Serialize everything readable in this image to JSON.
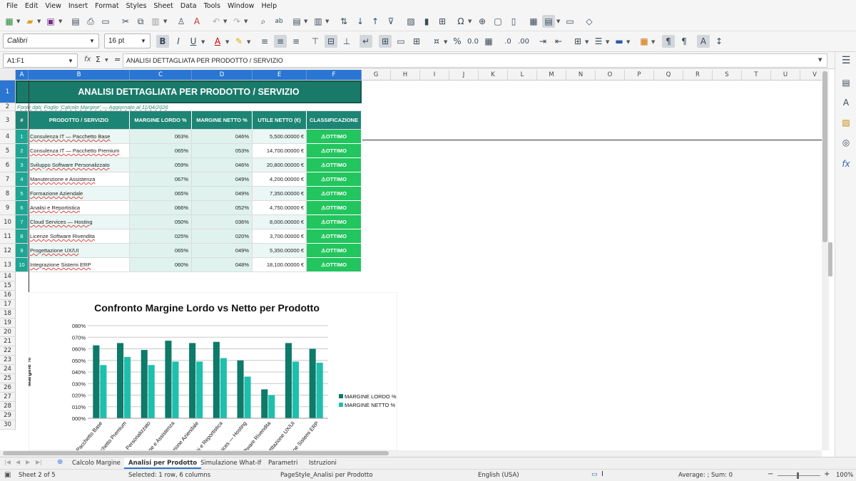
{
  "menu": [
    "File",
    "Edit",
    "View",
    "Insert",
    "Format",
    "Styles",
    "Sheet",
    "Data",
    "Tools",
    "Window",
    "Help"
  ],
  "font": {
    "name": "Calibri",
    "size": "16 pt"
  },
  "formula_bar": {
    "cell_ref": "A1:F1",
    "content": "ANALISI DETTAGLIATA PER PRODOTTO / SERVIZIO",
    "fx": "fx",
    "sigma": "Σ",
    "equals": "="
  },
  "columns": [
    "A",
    "B",
    "C",
    "D",
    "E",
    "F",
    "G",
    "H",
    "I",
    "J",
    "K",
    "L",
    "M",
    "N",
    "O",
    "P",
    "Q",
    "R",
    "S",
    "T",
    "U",
    "V"
  ],
  "rows": [
    "1",
    "2",
    "3",
    "4",
    "5",
    "6",
    "7",
    "8",
    "9",
    "10",
    "11",
    "12",
    "13",
    "14",
    "15",
    "16",
    "17",
    "18",
    "19",
    "20",
    "21",
    "22",
    "23",
    "24",
    "25",
    "26",
    "27",
    "28",
    "29",
    "30"
  ],
  "sheet": {
    "title": "ANALISI DETTAGLIATA PER PRODOTTO / SERVIZIO",
    "subtitle": "Fonte dati: Foglio 'Calcolo Margine' — Aggiornato al 11/04/2026",
    "headers": [
      "#",
      "PRODOTTO / SERVIZIO",
      "MARGINE LORDO %",
      "MARGINE NETTO %",
      "UTILE NETTO (€)",
      "CLASSIFICAZIONE"
    ],
    "table": [
      [
        "1",
        "Consulenza IT — Pacchetto Base",
        "063%",
        "046%",
        "5,500.00000 €",
        "⚠OTTIMO"
      ],
      [
        "2",
        "Consulenza IT — Pacchetto Premium",
        "065%",
        "053%",
        "14,700.00000 €",
        "⚠OTTIMO"
      ],
      [
        "3",
        "Sviluppo Software Personalizzato",
        "059%",
        "046%",
        "20,800.00000 €",
        "⚠OTTIMO"
      ],
      [
        "4",
        "Manutenzione e Assistenza",
        "067%",
        "049%",
        "4,200.00000 €",
        "⚠OTTIMO"
      ],
      [
        "5",
        "Formazione Aziendale",
        "065%",
        "049%",
        "7,350.00000 €",
        "⚠OTTIMO"
      ],
      [
        "6",
        "Analisi e Reportistica",
        "066%",
        "052%",
        "4,750.00000 €",
        "⚠OTTIMO"
      ],
      [
        "7",
        "Cloud Services — Hosting",
        "050%",
        "036%",
        "8,000.00000 €",
        "⚠OTTIMO"
      ],
      [
        "8",
        "Licenze Software Rivendita",
        "025%",
        "020%",
        "3,700.00000 €",
        "⚠OTTIMO"
      ],
      [
        "9",
        "Progettazione UX/UI",
        "065%",
        "049%",
        "5,350.00000 €",
        "⚠OTTIMO"
      ],
      [
        "10",
        "Integrazione Sistemi ERP",
        "060%",
        "048%",
        "18,100.00000 €",
        "⚠OTTIMO"
      ]
    ]
  },
  "chart_data": {
    "type": "bar",
    "title": "Confronto Margine Lordo vs Netto per Prodotto",
    "xlabel": "",
    "ylabel": "Margine %",
    "categories": [
      "Pacchetto Base",
      "Pacchetto Premium",
      "Personalizzato",
      "Manutenzione e Assistenza",
      "Formazione Aziendale",
      "Analisi e Reportistica",
      "Cloud Services — Hosting",
      "Software Rivendita",
      "Progettazione UX/UI",
      "Integrazione Sistemi ERP"
    ],
    "series": [
      {
        "name": "MARGINE LORDO %",
        "values": [
          63,
          65,
          59,
          67,
          65,
          66,
          50,
          25,
          65,
          60
        ],
        "color": "#0e7a6a"
      },
      {
        "name": "MARGINE NETTO %",
        "values": [
          46,
          53,
          46,
          49,
          49,
          52,
          36,
          20,
          49,
          48
        ],
        "color": "#1fbfae"
      }
    ],
    "ylim": [
      0,
      80
    ],
    "ytick_labels": [
      "000%",
      "010%",
      "020%",
      "030%",
      "040%",
      "050%",
      "060%",
      "070%",
      "080%"
    ],
    "grid": true,
    "legend": "right"
  },
  "tabs": [
    "Calcolo Margine",
    "Analisi per Prodotto",
    "Simulazione What-If",
    "Parametri",
    "Istruzioni"
  ],
  "status": {
    "sheet": "Sheet 2 of 5",
    "selection": "Selected: 1 row, 6 columns",
    "page_style": "PageStyle_Analisi per Prodotto",
    "language": "English (USA)",
    "sum": "Average: ; Sum: 0",
    "zoom": "100%"
  },
  "colors": {
    "title_bg": "#1a7a6a",
    "header_bg": "#1d8575",
    "class_bg": "#22c55e",
    "selection": "#2a76d2"
  }
}
